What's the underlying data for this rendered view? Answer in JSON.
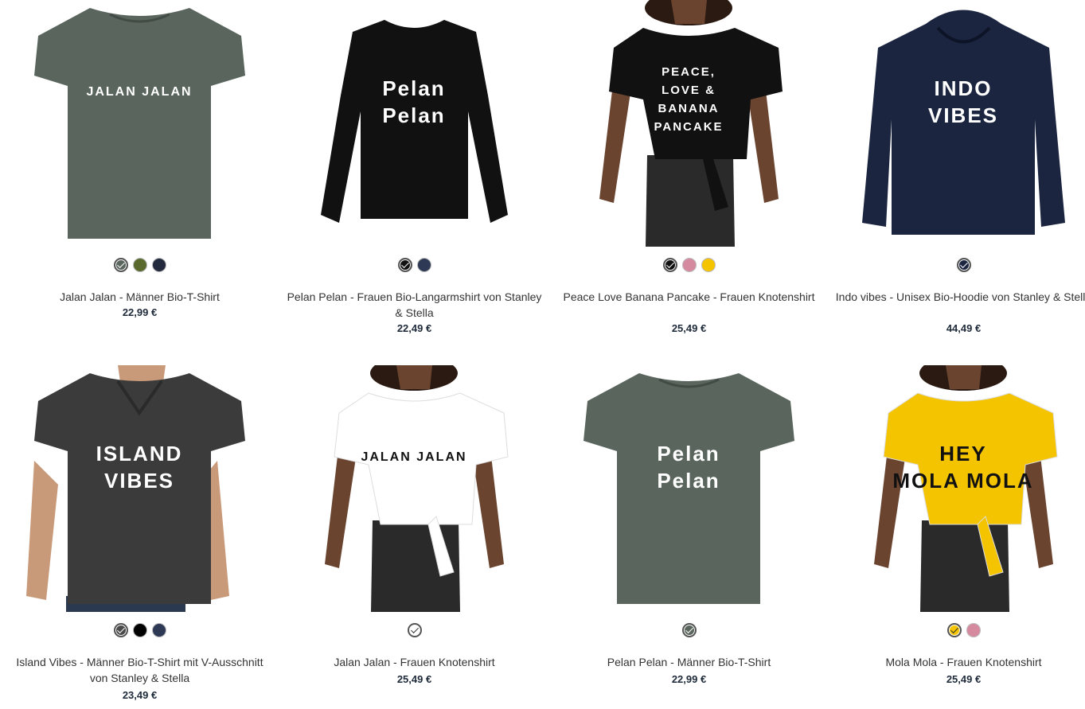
{
  "products": [
    {
      "title": "Jalan Jalan - Männer Bio-T-Shirt",
      "price": "22,99 €",
      "garment_color": "#59655d",
      "print_lines": [
        "JALAN JALAN"
      ],
      "icon": "tshirt-icon",
      "swatches": [
        {
          "color": "#59655d",
          "selected": true
        },
        {
          "color": "#5a6a2e",
          "selected": false
        },
        {
          "color": "#242a3d",
          "selected": false
        }
      ]
    },
    {
      "title": "Pelan Pelan - Frauen Bio-Langarmshirt von Stanley & Stella",
      "price": "22,49 €",
      "garment_color": "#111111",
      "print_lines": [
        "Pelan",
        "Pelan"
      ],
      "icon": "longsleeve-icon",
      "swatches": [
        {
          "color": "#111111",
          "selected": true
        },
        {
          "color": "#2e3a55",
          "selected": false
        }
      ]
    },
    {
      "title": "Peace Love Banana Pancake - Frauen Knotenshirt",
      "price": "25,49 €",
      "garment_color": "#111111",
      "print_lines": [
        "PEACE,",
        "LOVE &",
        "BANANA",
        "PANCAKE"
      ],
      "icon": "knot-shirt-icon",
      "swatches": [
        {
          "color": "#111111",
          "selected": true
        },
        {
          "color": "#d68aa0",
          "selected": false
        },
        {
          "color": "#f5c400",
          "selected": false
        }
      ]
    },
    {
      "title": "Indo vibes - Unisex Bio-Hoodie von Stanley & Stella",
      "price": "44,49 €",
      "garment_color": "#1b2540",
      "print_lines": [
        "INDO",
        "VIBES"
      ],
      "icon": "hoodie-icon",
      "swatches": [
        {
          "color": "#1b2540",
          "selected": true
        }
      ]
    },
    {
      "title": "Island Vibes - Männer Bio-T-Shirt mit V-Ausschnitt von Stanley & Stella",
      "price": "23,49 €",
      "garment_color": "#3b3b3b",
      "print_lines": [
        "ISLAND",
        "VIBES"
      ],
      "icon": "vneck-icon",
      "swatches": [
        {
          "color": "#4a4a4a",
          "selected": true
        },
        {
          "color": "#000000",
          "selected": false
        },
        {
          "color": "#2e3a55",
          "selected": false
        }
      ]
    },
    {
      "title": "Jalan Jalan - Frauen Knotenshirt",
      "price": "25,49 €",
      "garment_color": "#ffffff",
      "print_lines": [
        "JALAN JALAN"
      ],
      "icon": "knot-shirt-icon",
      "swatches": [
        {
          "color": "#ffffff",
          "selected": true
        }
      ]
    },
    {
      "title": "Pelan Pelan - Männer Bio-T-Shirt",
      "price": "22,99 €",
      "garment_color": "#59655d",
      "print_lines": [
        "Pelan",
        "Pelan"
      ],
      "icon": "tshirt-icon",
      "swatches": [
        {
          "color": "#59655d",
          "selected": true
        }
      ]
    },
    {
      "title": "Mola Mola - Frauen Knotenshirt",
      "price": "25,49 €",
      "garment_color": "#f5c400",
      "print_lines": [
        "HEY",
        "MOLA MOLA"
      ],
      "icon": "knot-shirt-icon",
      "swatches": [
        {
          "color": "#f5c400",
          "selected": true
        },
        {
          "color": "#d68aa0",
          "selected": false
        }
      ]
    }
  ]
}
